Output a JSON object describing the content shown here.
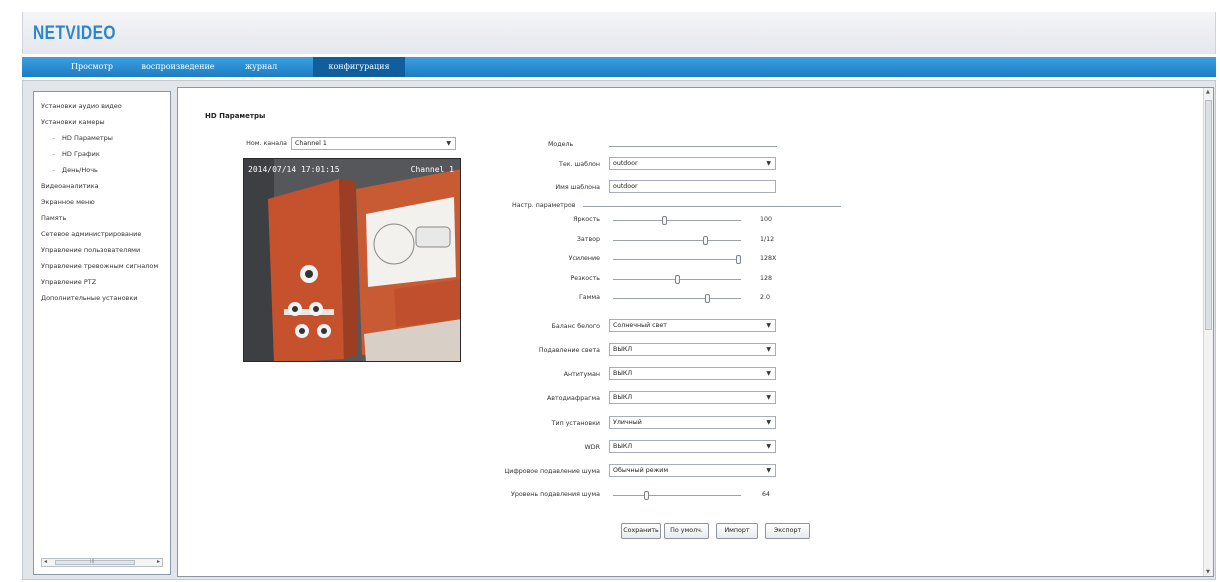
{
  "app": {
    "logo": "NETVIDEO"
  },
  "nav": {
    "items": [
      {
        "label": "Просмотр"
      },
      {
        "label": "воспроизведение"
      },
      {
        "label": "журнал"
      },
      {
        "label": "конфигурация",
        "active": true
      }
    ]
  },
  "sidebar": {
    "items": [
      {
        "label": "Установки аудио видео"
      },
      {
        "label": "Установки камеры"
      },
      {
        "label": "HD Параметры",
        "child": true
      },
      {
        "label": "HD График",
        "child": true
      },
      {
        "label": "День/Ночь",
        "child": true
      },
      {
        "label": "Видеоаналитика"
      },
      {
        "label": "Экранное меню"
      },
      {
        "label": "Память"
      },
      {
        "label": "Сетевое администрирование"
      },
      {
        "label": "Управление пользователями"
      },
      {
        "label": "Управление тревожным сигналом"
      },
      {
        "label": "Управление PTZ"
      },
      {
        "label": "Дополнительные установки"
      }
    ],
    "scroll_grip": "III"
  },
  "page": {
    "title": "HD Параметры",
    "channel_label": "Ном. канала",
    "channel_value": "Channel 1"
  },
  "video": {
    "timestamp": "2014/07/14 17:01:15",
    "channel_osd": "Channel 1"
  },
  "settings": {
    "model_label": "Модель",
    "model_value": "",
    "template_label": "Тек. шаблон",
    "template_value": "outdoor",
    "template_name_label": "Имя шаблона",
    "template_name_value": "outdoor",
    "params_label": "Настр. параметров",
    "sliders": [
      {
        "label": "Яркость",
        "value": "100",
        "level": 0.4
      },
      {
        "label": "Затвор",
        "value": "1/12",
        "level": 0.73
      },
      {
        "label": "Усиление",
        "value": "128X",
        "level": 1.0
      },
      {
        "label": "Резкость",
        "value": "128",
        "level": 0.5
      },
      {
        "label": "Гамма",
        "value": "2.0",
        "level": 0.75
      }
    ],
    "selects": [
      {
        "label": "Баланс белого",
        "value": "Солнечный свет"
      },
      {
        "label": "Подавление света",
        "value": "ВЫКЛ"
      },
      {
        "label": "Антитуман",
        "value": "ВЫКЛ"
      },
      {
        "label": "Автодиафрагма",
        "value": "ВЫКЛ"
      },
      {
        "label": "Тип установки",
        "value": "Уличный"
      },
      {
        "label": "WDR",
        "value": "ВЫКЛ"
      },
      {
        "label": "Цифровое подавление шума",
        "value": "Обычный режим"
      }
    ],
    "noise_label": "Уровень подавления шума",
    "noise_value": "64",
    "noise_level": 0.25
  },
  "buttons": {
    "save": "Сохранить",
    "default": "По умолч.",
    "import": "Импорт",
    "export": "Экспорт"
  }
}
